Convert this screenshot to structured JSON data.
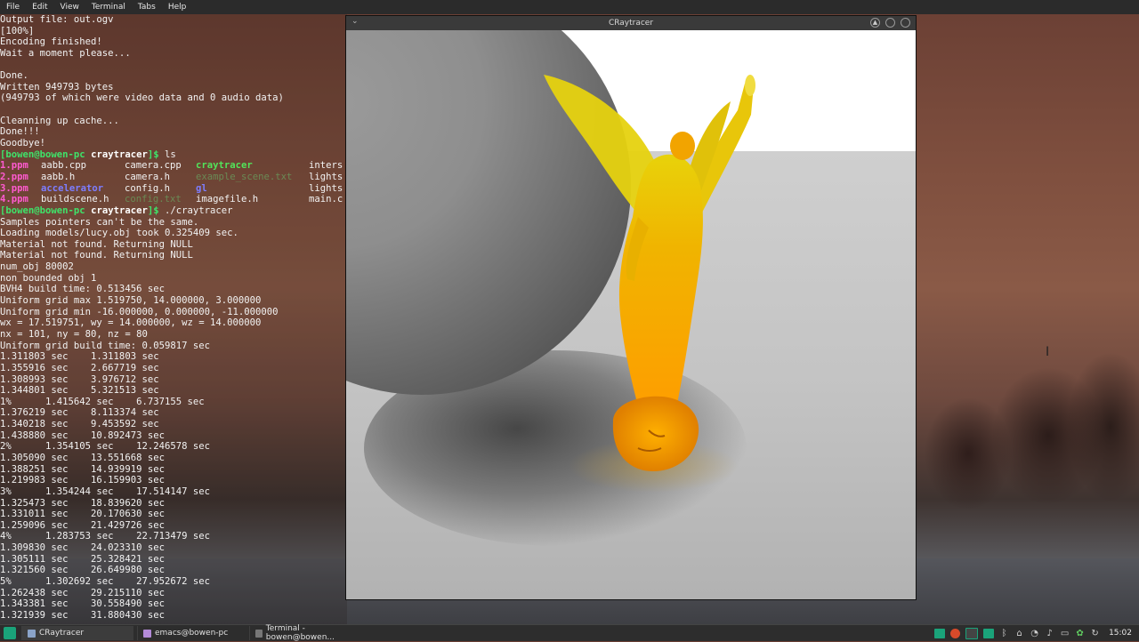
{
  "menubar": {
    "items": [
      "File",
      "Edit",
      "View",
      "Terminal",
      "Tabs",
      "Help"
    ]
  },
  "terminal": {
    "lines_top": [
      "Output file: out.ogv",
      "[100%]",
      "Encoding finished!",
      "Wait a moment please...",
      "",
      "Done.",
      "Written 949793 bytes",
      "(949793 of which were video data and 0 audio data)",
      "",
      "Cleanning up cache...",
      "Done!!!",
      "Goodbye!"
    ],
    "prompt1": {
      "user_host": "[bowen@bowen-pc ",
      "dir": "craytracer",
      "tail": "]$ ",
      "cmd": "ls"
    },
    "ls_rows": [
      [
        "1.ppm",
        "aabb.cpp",
        "camera.cpp",
        "craytracer",
        "inters"
      ],
      [
        "2.ppm",
        "aabb.h",
        "camera.h",
        "example_scene.txt",
        "lights"
      ],
      [
        "3.ppm",
        "accelerator",
        "config.h",
        "gl",
        "lights"
      ],
      [
        "4.ppm",
        "buildscene.h",
        "config.txt",
        "imagefile.h",
        "main.c"
      ]
    ],
    "prompt2": {
      "user_host": "[bowen@bowen-pc ",
      "dir": "craytracer",
      "tail": "]$ ",
      "cmd": "./craytracer"
    },
    "lines_bottom": [
      "Samples pointers can't be the same.",
      "Loading models/lucy.obj took 0.325409 sec.",
      "Material not found. Returning NULL",
      "Material not found. Returning NULL",
      "num_obj 80002",
      "non bounded obj 1",
      "BVH4 build time: 0.513456 sec",
      "Uniform grid max 1.519750, 14.000000, 3.000000",
      "Uniform grid min -16.000000, 0.000000, -11.000000",
      "wx = 17.519751, wy = 14.000000, wz = 14.000000",
      "nx = 101, ny = 80, nz = 80",
      "Uniform grid build time: 0.059817 sec",
      "1.311803 sec    1.311803 sec",
      "1.355916 sec    2.667719 sec",
      "1.308993 sec    3.976712 sec",
      "1.344801 sec    5.321513 sec",
      "1%      1.415642 sec    6.737155 sec",
      "1.376219 sec    8.113374 sec",
      "1.340218 sec    9.453592 sec",
      "1.438880 sec    10.892473 sec",
      "2%      1.354105 sec    12.246578 sec",
      "1.305090 sec    13.551668 sec",
      "1.388251 sec    14.939919 sec",
      "1.219983 sec    16.159903 sec",
      "3%      1.354244 sec    17.514147 sec",
      "1.325473 sec    18.839620 sec",
      "1.331011 sec    20.170630 sec",
      "1.259096 sec    21.429726 sec",
      "4%      1.283753 sec    22.713479 sec",
      "1.309830 sec    24.023310 sec",
      "1.305111 sec    25.328421 sec",
      "1.321560 sec    26.649980 sec",
      "5%      1.302692 sec    27.952672 sec",
      "1.262438 sec    29.215110 sec",
      "1.343381 sec    30.558490 sec",
      "1.321939 sec    31.880430 sec"
    ]
  },
  "raytracer_window": {
    "title": "CRaytracer",
    "menu_icon": "chevron-down-icon",
    "controls": [
      "up-arrow-icon",
      "minimize-icon",
      "close-icon"
    ]
  },
  "taskbar": {
    "tasks": [
      "CRaytracer",
      "emacs@bowen-pc",
      "Terminal - bowen@bowen..."
    ],
    "clock": "15:02",
    "accent": "#1aa37a"
  }
}
